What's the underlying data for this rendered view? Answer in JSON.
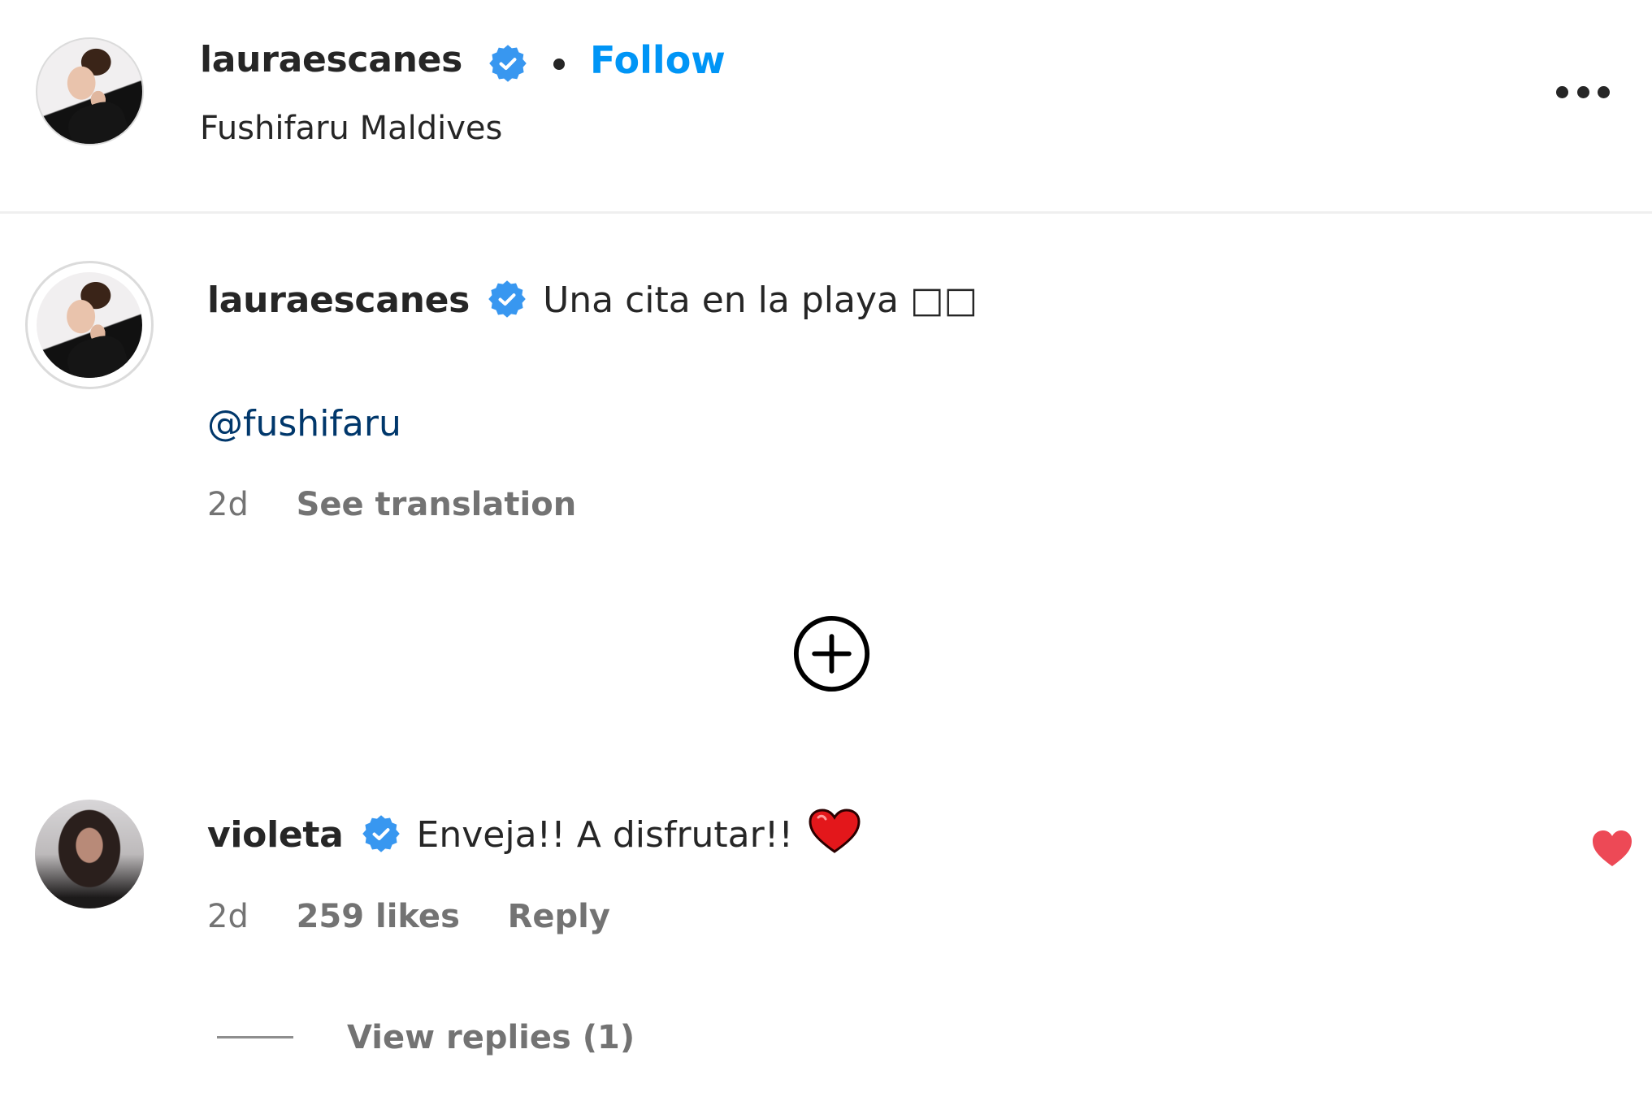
{
  "post_header": {
    "username": "lauraescanes",
    "verified": true,
    "separator": "•",
    "follow_label": "Follow",
    "location": "Fushifaru Maldives",
    "more_icon": "more-horizontal-icon"
  },
  "caption": {
    "username": "lauraescanes",
    "verified": true,
    "text": "Una cita en la playa □□",
    "mention": "@fushifaru",
    "time": "2d",
    "see_translation_label": "See translation"
  },
  "load_more": {
    "icon": "plus-circle-icon"
  },
  "comments": [
    {
      "username": "violeta",
      "verified": true,
      "text": "Enveja!! A disfrutar!!",
      "emoji": "red-heart",
      "time": "2d",
      "likes_label": "259 likes",
      "reply_label": "Reply",
      "liked": true,
      "view_replies_label": "View replies (1)"
    }
  ],
  "colors": {
    "link_blue": "#0095f6",
    "mention_blue": "#00376b",
    "verified_blue": "#3897f0",
    "like_red": "#ed4956",
    "secondary_text": "#737373",
    "primary_text": "#262626"
  }
}
